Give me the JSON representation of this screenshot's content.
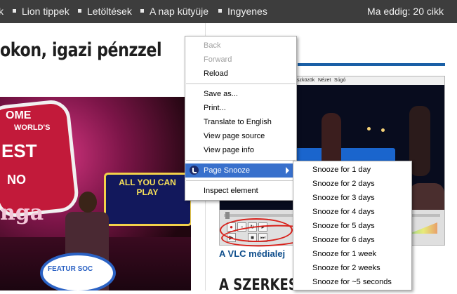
{
  "topbar": {
    "nav": [
      {
        "label": "k"
      },
      {
        "label": "Lion tippek"
      },
      {
        "label": "Letöltések"
      },
      {
        "label": "A nap kütyüje"
      },
      {
        "label": "Ingyenes"
      }
    ],
    "counter": "Ma eddig: 20 cikk"
  },
  "article": {
    "headline": "okon, igazi pénzzel",
    "photo_texts": {
      "sign_top": "OME",
      "sign_mid": "WORLD'S",
      "sign_big": "EST",
      "sign_low": "NO",
      "allyou": "ALL YOU CAN PLAY",
      "nga": "nga",
      "badge": "FEATUR SOC"
    }
  },
  "sidebar": {
    "vlc_menu": [
      "szközök",
      "Nézet",
      "Súgó"
    ],
    "vlc_caption": "A VLC médialej",
    "szerk_heading": "A SZERKESZ"
  },
  "context_menu": {
    "items": [
      {
        "label": "Back",
        "disabled": true
      },
      {
        "label": "Forward",
        "disabled": true
      },
      {
        "label": "Reload",
        "disabled": false
      },
      {
        "label": "Save as...",
        "disabled": false
      },
      {
        "label": "Print...",
        "disabled": false
      },
      {
        "label": "Translate to English",
        "disabled": false
      },
      {
        "label": "View page source",
        "disabled": false
      },
      {
        "label": "View page info",
        "disabled": false
      },
      {
        "label": "Page Snooze",
        "disabled": false,
        "active": true,
        "has_submenu": true,
        "icon": "snooze-icon"
      },
      {
        "label": "Inspect element",
        "disabled": false
      }
    ]
  },
  "snooze_submenu": {
    "items": [
      {
        "label": "Snooze for 1 day"
      },
      {
        "label": "Snooze for 2 days"
      },
      {
        "label": "Snooze for 3 days"
      },
      {
        "label": "Snooze for 4 days"
      },
      {
        "label": "Snooze for 5 days"
      },
      {
        "label": "Snooze for 6 days"
      },
      {
        "label": "Snooze for 1 week"
      },
      {
        "label": "Snooze for 2 weeks"
      },
      {
        "label": "Snooze for ~5 seconds"
      }
    ]
  },
  "colors": {
    "topbar_bg": "#3d3d3d",
    "menu_highlight": "#3870cc",
    "accent_blue": "#1a5fa6",
    "annotation_red": "#d8201a"
  }
}
